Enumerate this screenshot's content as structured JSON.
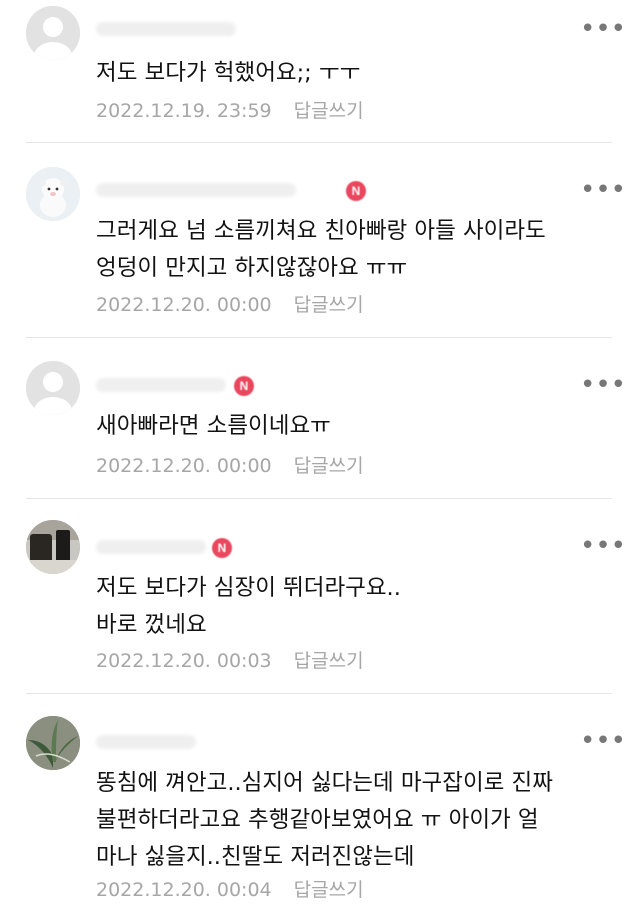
{
  "comments": [
    {
      "text": "저도 보다가 헉했어요;; ㅜㅜ",
      "date": "2022.12.19. 23:59",
      "reply": "답글쓰기",
      "more": "•••"
    },
    {
      "text": "그러게요 넘 소름끼쳐요 친아빠랑 아들 사이라도\n엉덩이 만지고 하지않잖아요 ㅠㅠ",
      "date": "2022.12.20. 00:00",
      "reply": "답글쓰기",
      "more": "•••"
    },
    {
      "text": "새아빠라면 소름이네요ㅠ",
      "date": "2022.12.20. 00:00",
      "reply": "답글쓰기",
      "more": "•••"
    },
    {
      "text": "저도 보다가 심장이 뛰더라구요..\n바로 껐네요",
      "date": "2022.12.20. 00:03",
      "reply": "답글쓰기",
      "more": "•••"
    },
    {
      "text": "똥침에 껴안고..심지어 싫다는데 마구잡이로 진짜\n불편하더라고요 추행같아보였어요 ㅠ 아이가 얼\n마나 싫을지..친딸도 저러진않는데",
      "date": "2022.12.20. 00:04",
      "reply": "답글쓰기",
      "more": "•••"
    }
  ],
  "badge_letter": "N"
}
